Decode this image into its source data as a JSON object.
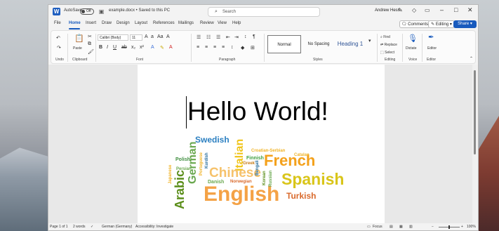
{
  "titlebar": {
    "autosave_label": "AutoSave",
    "autosave_state": "Off",
    "doc_title": "example.docx • Saved to this PC",
    "search_placeholder": "Search",
    "user_name": "Andrew Hess"
  },
  "tabs": [
    "File",
    "Home",
    "Insert",
    "Draw",
    "Design",
    "Layout",
    "References",
    "Mailings",
    "Review",
    "View",
    "Help"
  ],
  "active_tab": "Home",
  "actions": {
    "comments": "Comments",
    "editing": "Editing",
    "share": "Share"
  },
  "ribbon": {
    "paste": "Paste",
    "font_name": "Calibri (Body)",
    "font_size": "11",
    "styles": {
      "normal": "Normal",
      "no_spacing": "No Spacing",
      "heading1": "Heading 1"
    },
    "find": "Find",
    "replace": "Replace",
    "select": "Select",
    "dictate": "Dictate",
    "editor": "Editor",
    "groups": {
      "undo": "Undo",
      "clipboard": "Clipboard",
      "font": "Font",
      "paragraph": "Paragraph",
      "styles": "Styles",
      "editing": "Editing",
      "voice": "Voice",
      "editor": "Editor"
    }
  },
  "document": {
    "heading": "Hello World!",
    "wordcloud": [
      {
        "text": "Swedish",
        "color": "#2a7fc1"
      },
      {
        "text": "Italian",
        "color": "#f0c419"
      },
      {
        "text": "German",
        "color": "#6aa84f"
      },
      {
        "text": "Arabic",
        "color": "#5b8e1a"
      },
      {
        "text": "French",
        "color": "#f4a11b"
      },
      {
        "text": "Chinese",
        "color": "#f6c26b"
      },
      {
        "text": "Spanish",
        "color": "#d9c51a"
      },
      {
        "text": "English",
        "color": "#f4a246"
      },
      {
        "text": "Turkish",
        "color": "#d9692b"
      },
      {
        "text": "Croatian-Serbian",
        "color": "#f0b429"
      },
      {
        "text": "Catalan",
        "color": "#f0b429"
      },
      {
        "text": "Finnish",
        "color": "#3f9e3f"
      },
      {
        "text": "Greek",
        "color": "#c77d1a"
      },
      {
        "text": "Polish",
        "color": "#3f8e3f"
      },
      {
        "text": "Kurdish",
        "color": "#2a6f9e"
      },
      {
        "text": "Portuguese",
        "color": "#f0b429"
      },
      {
        "text": "Persian",
        "color": "#6aa84f"
      },
      {
        "text": "Danish",
        "color": "#6aa84f"
      },
      {
        "text": "Norwegian",
        "color": "#d9692b"
      },
      {
        "text": "Korean",
        "color": "#5b8e1a"
      },
      {
        "text": "Japanese",
        "color": "#f0b429"
      },
      {
        "text": "Russian",
        "color": "#6aa84f"
      },
      {
        "text": "Bengali",
        "color": "#2a6f9e"
      }
    ]
  },
  "status": {
    "page": "Page 1 of 1",
    "words": "2 words",
    "language": "German (Germany)",
    "accessibility": "Accessibility: Investigate",
    "focus": "Focus",
    "zoom": "100%"
  },
  "colors": {
    "accent": "#185abd"
  }
}
